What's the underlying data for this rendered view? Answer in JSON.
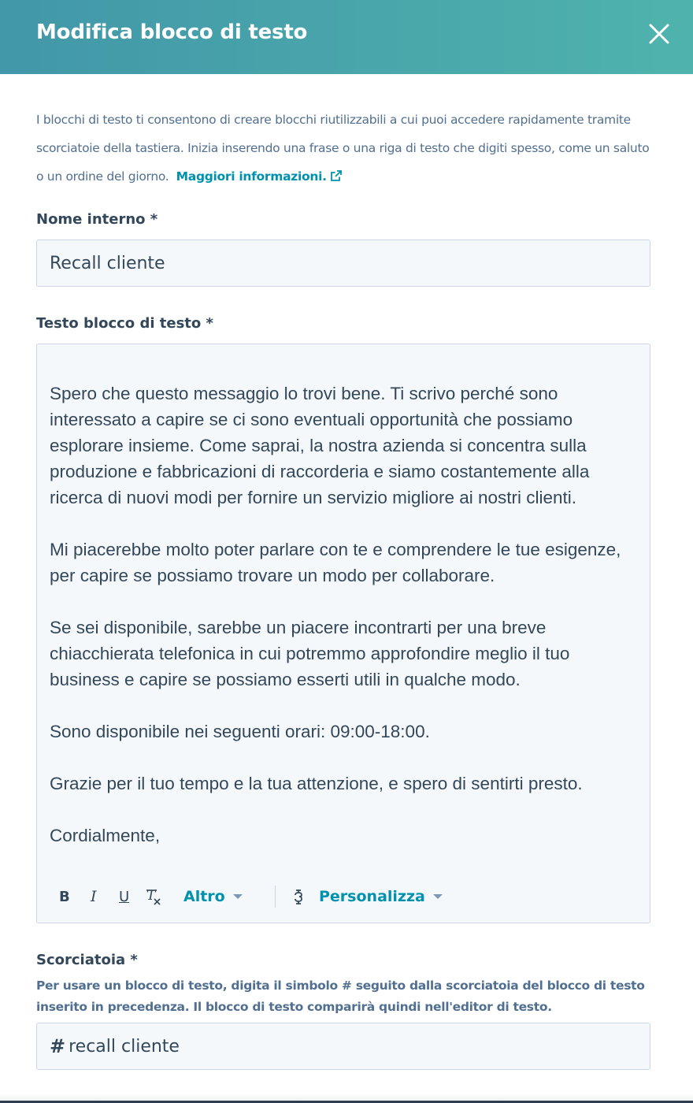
{
  "header": {
    "title": "Modifica blocco di testo",
    "close_icon": "close-icon"
  },
  "intro": {
    "text": "I blocchi di testo ti consentono di creare blocchi riutilizzabili a cui puoi accedere rapidamente tramite scorciatoie della tastiera. Inizia inserendo una frase o una riga di testo che digiti spesso, come un saluto o un ordine del giorno.",
    "link_label": "Maggiori informazioni.",
    "link_icon": "external-link-icon"
  },
  "fields": {
    "name": {
      "label": "Nome interno *",
      "value": "Recall cliente"
    },
    "body": {
      "label": "Testo blocco di testo *",
      "paragraphs": [
        "Spero che questo messaggio lo trovi bene. Ti scrivo perché sono interessato a capire se ci sono eventuali opportunità che possiamo esplorare insieme. Come saprai, la nostra azienda si concentra sulla produzione e fabbricazioni di raccorderia e siamo costantemente alla ricerca di nuovi modi per fornire un servizio migliore ai nostri clienti.",
        "Mi piacerebbe molto poter parlare con te e comprendere le tue esigenze, per capire se possiamo trovare un modo per collaborare.",
        "Se sei disponibile, sarebbe un piacere incontrarti per una breve chiacchierata telefonica in cui potremmo approfondire meglio il tuo business e capire se possiamo esserti utili in qualche modo.",
        "Sono disponibile nei seguenti orari: 09:00-18:00.",
        "Grazie per il tuo tempo e la tua attenzione, e spero di sentirti presto.",
        "Cordialmente,"
      ]
    },
    "shortcut": {
      "label": "Scorciatoia *",
      "help": "Per usare un blocco di testo, digita il simbolo # seguito dalla scorciatoia del blocco di testo inserito in precedenza. Il blocco di testo comparirà quindi nell'editor di testo.",
      "prefix": "#",
      "value": "recall cliente"
    }
  },
  "toolbar": {
    "bold": "B",
    "italic": "I",
    "underline": "U",
    "clear_format_icon": "clear-format-icon",
    "more_label": "Altro",
    "token_icon": "token-icon",
    "personalize_label": "Personalizza"
  },
  "colors": {
    "header_gradient_start": "#4297a8",
    "header_gradient_end": "#4fb3ad",
    "link": "#0091ae",
    "text": "#33475b",
    "muted": "#516f90",
    "field_bg": "#f5f8fa",
    "field_border": "#cbd6e2"
  }
}
